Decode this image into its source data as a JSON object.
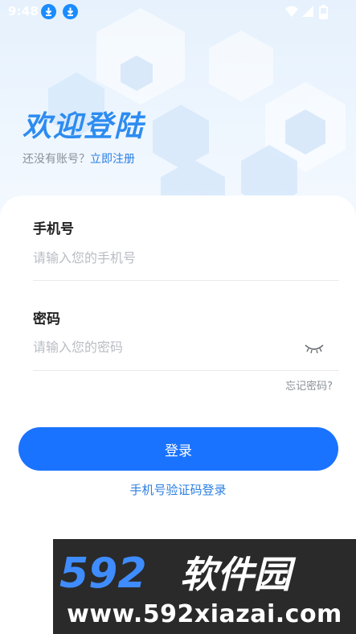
{
  "status_bar": {
    "time": "9:48",
    "icons": [
      "download-icon",
      "download-icon",
      "wifi-icon",
      "signal-icon",
      "battery-icon"
    ]
  },
  "header": {
    "title": "欢迎登陆",
    "no_account_text": "还没有账号？",
    "register_link": "立即注册"
  },
  "form": {
    "phone": {
      "label": "手机号",
      "placeholder": "请输入您的手机号",
      "value": ""
    },
    "password": {
      "label": "密码",
      "placeholder": "请输入您的密码",
      "value": "",
      "toggle_icon": "eye-closed-icon"
    },
    "forgot_link": "忘记密码?",
    "login_button": "登录",
    "sms_login_link": "手机号验证码登录"
  },
  "watermark": {
    "brand": "592软件园",
    "url": "www.592xiazai.com"
  },
  "colors": {
    "primary": "#1a73ff",
    "link": "#2b7fe3",
    "title": "#2d8cf0",
    "hero_bg": "#e6f1fd",
    "watermark_bg": "#2a2a2a"
  }
}
